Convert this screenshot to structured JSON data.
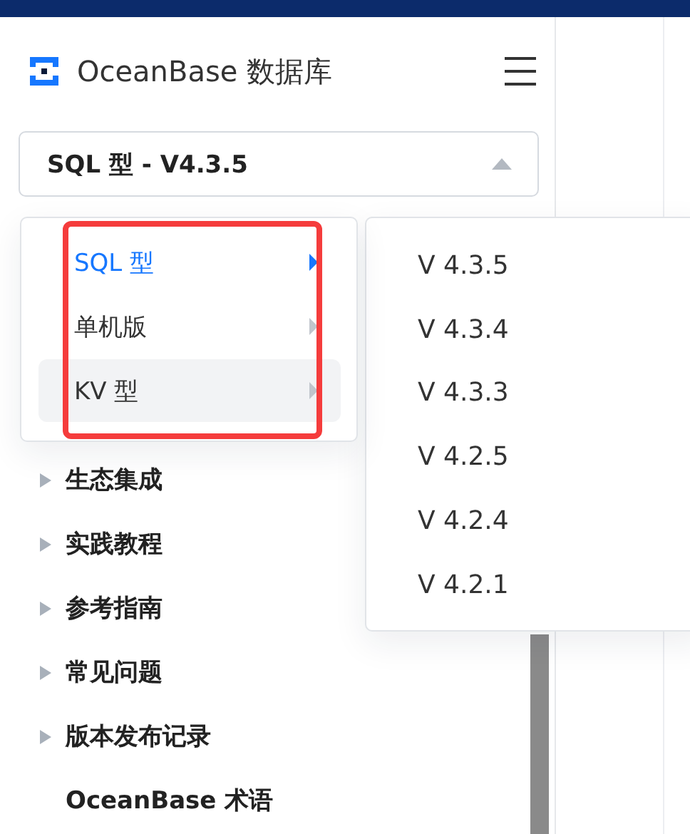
{
  "header": {
    "title": "OceanBase 数据库"
  },
  "select": {
    "value": "SQL 型 - V4.3.5",
    "expanded": true
  },
  "cascader": {
    "types": [
      {
        "label": "SQL 型",
        "selected": true,
        "hovered": false
      },
      {
        "label": "单机版",
        "selected": false,
        "hovered": false
      },
      {
        "label": "KV 型",
        "selected": false,
        "hovered": true
      }
    ],
    "versions": [
      {
        "label": "V 4.3.5"
      },
      {
        "label": "V 4.3.4"
      },
      {
        "label": "V 4.3.3"
      },
      {
        "label": "V 4.2.5"
      },
      {
        "label": "V 4.2.4"
      },
      {
        "label": "V 4.2.1"
      }
    ]
  },
  "tree": [
    {
      "label": "生态集成",
      "kind": "group"
    },
    {
      "label": "实践教程",
      "kind": "group"
    },
    {
      "label": "参考指南",
      "kind": "group"
    },
    {
      "label": "常见问题",
      "kind": "group"
    },
    {
      "label": "版本发布记录",
      "kind": "group"
    },
    {
      "label": "OceanBase 术语",
      "kind": "leaf"
    }
  ]
}
